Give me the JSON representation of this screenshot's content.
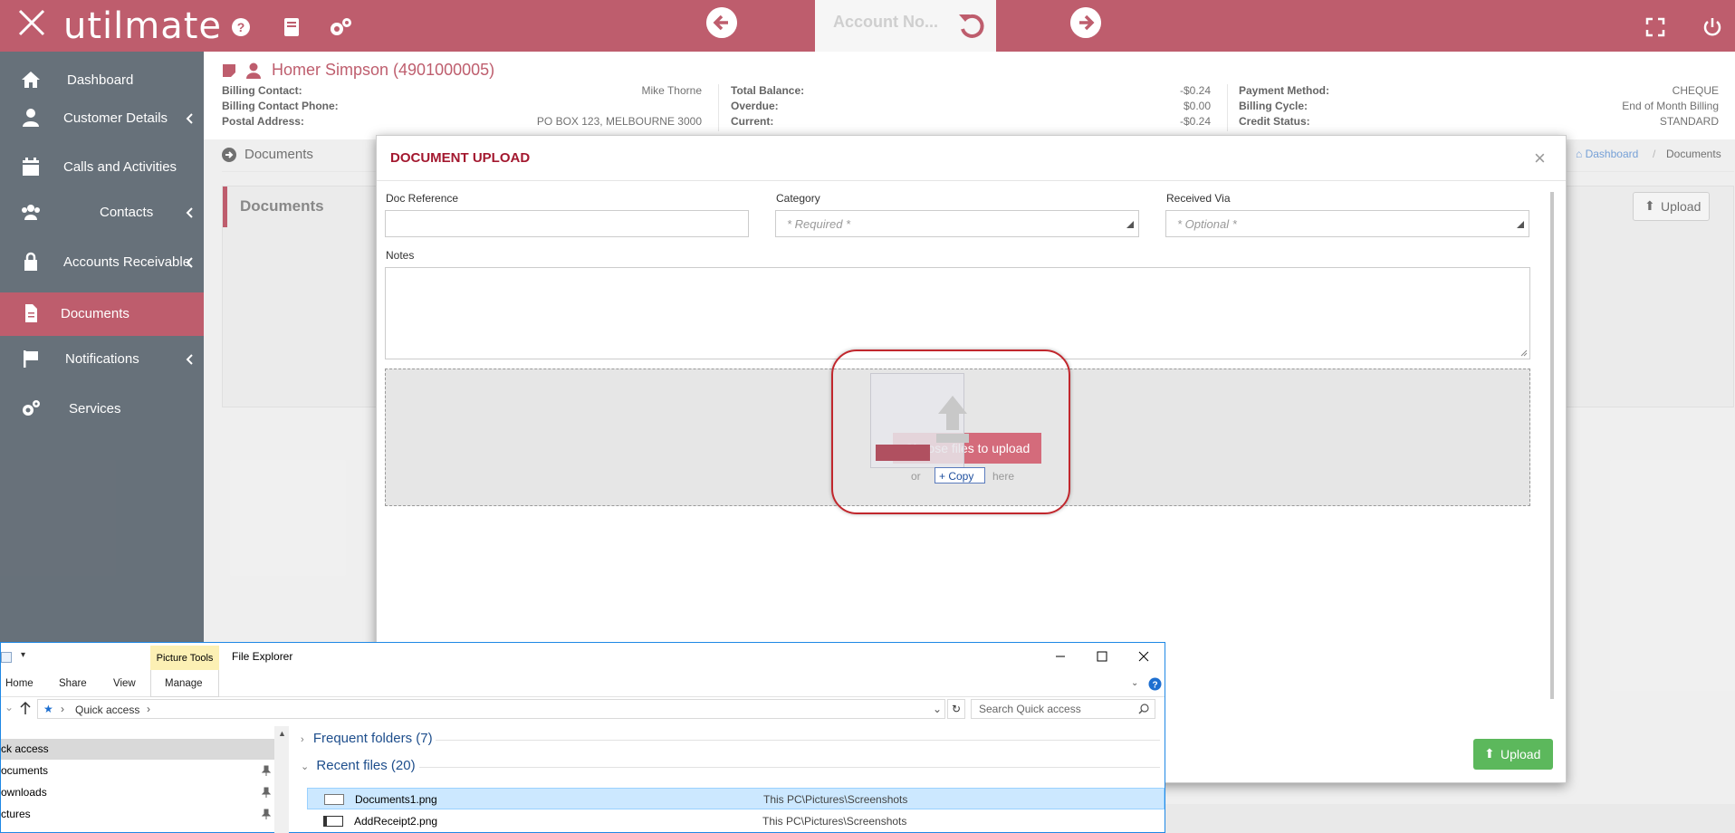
{
  "header": {
    "logo_text": "utilmate",
    "account_search_text": "Account No...",
    "brand_color": "#a3182f"
  },
  "sidebar": {
    "items": [
      {
        "label": "Dashboard",
        "icon": "home-icon"
      },
      {
        "label": "Customer Details",
        "icon": "user-icon"
      },
      {
        "label": "Calls and Activities",
        "icon": "calendar-icon"
      },
      {
        "label": "Contacts",
        "icon": "users-icon"
      },
      {
        "label": "Accounts Receivable",
        "icon": "lock-icon"
      },
      {
        "label": "Documents",
        "icon": "document-icon",
        "active": true
      },
      {
        "label": "Notifications",
        "icon": "flag-icon"
      },
      {
        "label": "Services",
        "icon": "gears-icon"
      }
    ]
  },
  "account": {
    "name": "Homer Simpson (4901000005)",
    "col1": [
      {
        "label": "Billing Contact:",
        "value": "Mike Thorne"
      },
      {
        "label": "Billing Contact Phone:",
        "value": ""
      },
      {
        "label": "Postal Address:",
        "value": "PO BOX 123, MELBOURNE 3000"
      }
    ],
    "col2": [
      {
        "label": "Total Balance:",
        "value": "-$0.24"
      },
      {
        "label": "Overdue:",
        "value": "$0.00"
      },
      {
        "label": "Current:",
        "value": "-$0.24"
      }
    ],
    "col3": [
      {
        "label": "Payment Method:",
        "value": "CHEQUE"
      },
      {
        "label": "Billing Cycle:",
        "value": "End of Month Billing"
      },
      {
        "label": "Credit Status:",
        "value": "STANDARD"
      }
    ]
  },
  "page": {
    "crumb_title": "Documents",
    "panel_title": "Documents",
    "breadcrumb_dashboard": "Dashboard",
    "breadcrumb_sep": "/",
    "breadcrumb_current": "Documents",
    "upload_label": "Upload"
  },
  "modal": {
    "title": "DOCUMENT UPLOAD",
    "close_symbol": "×",
    "doc_reference_label": "Doc Reference",
    "doc_reference_value": "",
    "category_label": "Category",
    "category_placeholder": "* Required *",
    "received_via_label": "Received Via",
    "received_via_placeholder": "* Optional *",
    "notes_label": "Notes",
    "choose_button": "Choose files to upload",
    "drop_hint_left": "or",
    "drop_hint_right": "here",
    "drag_copy_label": "+ Copy",
    "upload_button": "Upload",
    "upload_color": "#5cb85c"
  },
  "explorer": {
    "title": "File Explorer",
    "picture_tools": "Picture Tools",
    "ribbon_tabs": [
      "Home",
      "Share",
      "View",
      "Manage"
    ],
    "address_parts": [
      "Quick access"
    ],
    "search_placeholder": "Search Quick access",
    "nav_items": [
      {
        "label": "ck access",
        "pinned": false,
        "selected": true
      },
      {
        "label": "ocuments",
        "pinned": true
      },
      {
        "label": "ownloads",
        "pinned": true
      },
      {
        "label": "ctures",
        "pinned": true
      }
    ],
    "groups": [
      {
        "label": "Frequent folders (7)"
      },
      {
        "label": "Recent files (20)"
      }
    ],
    "files": [
      {
        "name": "Documents1.png",
        "path": "This PC\\Pictures\\Screenshots",
        "selected": true
      },
      {
        "name": "AddReceipt2.png",
        "path": "This PC\\Pictures\\Screenshots",
        "selected": false
      }
    ]
  }
}
